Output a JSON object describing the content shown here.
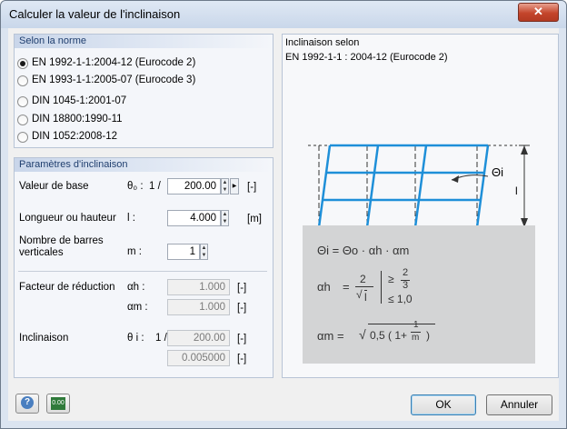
{
  "window": {
    "title": "Calculer la valeur de l'inclinaison",
    "close_glyph": "✕"
  },
  "norme": {
    "heading": "Selon la norme",
    "options": [
      {
        "label": "EN 1992-1-1:2004-12 (Eurocode 2)",
        "selected": true
      },
      {
        "label": "EN 1993-1-1:2005-07 (Eurocode 3)",
        "selected": false
      },
      {
        "label": "DIN 1045-1:2001-07",
        "selected": false
      },
      {
        "label": "DIN 18800:1990-11",
        "selected": false
      },
      {
        "label": "DIN 1052:2008-12",
        "selected": false
      }
    ]
  },
  "params": {
    "heading": "Paramètres d'inclinaison",
    "base": {
      "label": "Valeur de base",
      "symbol": "θ₀ :",
      "prefix": "1 /",
      "value": "200.00",
      "unit": "[-]"
    },
    "length": {
      "label": "Longueur ou hauteur",
      "symbol": "l :",
      "value": "4.000",
      "unit": "[m]"
    },
    "bars": {
      "label": "Nombre de barres verticales",
      "symbol": "m :",
      "value": "1"
    },
    "reduction": {
      "label": "Facteur de réduction",
      "alpha_h_symbol": "αh :",
      "alpha_h_value": "1.000",
      "alpha_m_symbol": "αm :",
      "alpha_m_value": "1.000",
      "unit": "[-]"
    },
    "inclination": {
      "label": "Inclinaison",
      "symbol": "θ i :",
      "prefix": "1 /",
      "value1": "200.00",
      "value2": "0.005000",
      "unit": "[-]"
    }
  },
  "diagram": {
    "heading_line1": "Inclinaison selon",
    "heading_line2": "EN 1992-1-1 : 2004-12  (Eurocode 2)",
    "theta_label": "Θi",
    "height_label": "l",
    "formula1": "Θi = Θo · αh · αm",
    "alpha_h": "αh",
    "eq": "=",
    "two": "2",
    "sqrt_l": "l",
    "geq": "≥",
    "two_thirds_num": "2",
    "two_thirds_den": "3",
    "leq": "≤ 1,0",
    "alpha_m": "αm =",
    "alpha_m_expr": "0,5 ( 1+",
    "one": "1",
    "m": "m",
    "close_paren": ")"
  },
  "footer": {
    "help_icon": "?",
    "calc_icon": "0.00",
    "ok_label": "OK",
    "cancel_label": "Annuler"
  }
}
